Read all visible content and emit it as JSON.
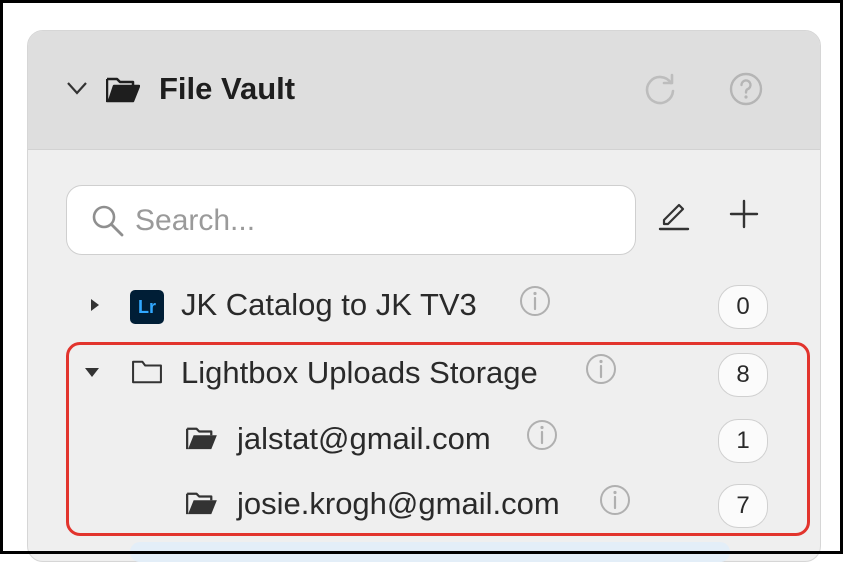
{
  "header": {
    "title": "File Vault",
    "icons": [
      "chevron-down-icon",
      "folder-open-icon",
      "refresh-icon",
      "help-icon"
    ]
  },
  "search": {
    "placeholder": "Search..."
  },
  "toolbar": {
    "icons": [
      "pencil-icon",
      "plus-icon"
    ]
  },
  "tree": {
    "items": [
      {
        "label": "JK Catalog to JK TV3",
        "count": "0",
        "icon": "lightroom-icon",
        "badge_text": "Lr",
        "expanded": false
      },
      {
        "label": "Lightbox Uploads Storage",
        "count": "8",
        "icon": "folder-icon",
        "expanded": true
      },
      {
        "label": "jalstat@gmail.com",
        "count": "1",
        "icon": "folder-open-icon"
      },
      {
        "label": "josie.krogh@gmail.com",
        "count": "7",
        "icon": "folder-open-icon"
      }
    ]
  },
  "colors": {
    "highlight": "#e2342d",
    "lightroom_bg": "#001e36",
    "lightroom_fg": "#31a8ff"
  }
}
